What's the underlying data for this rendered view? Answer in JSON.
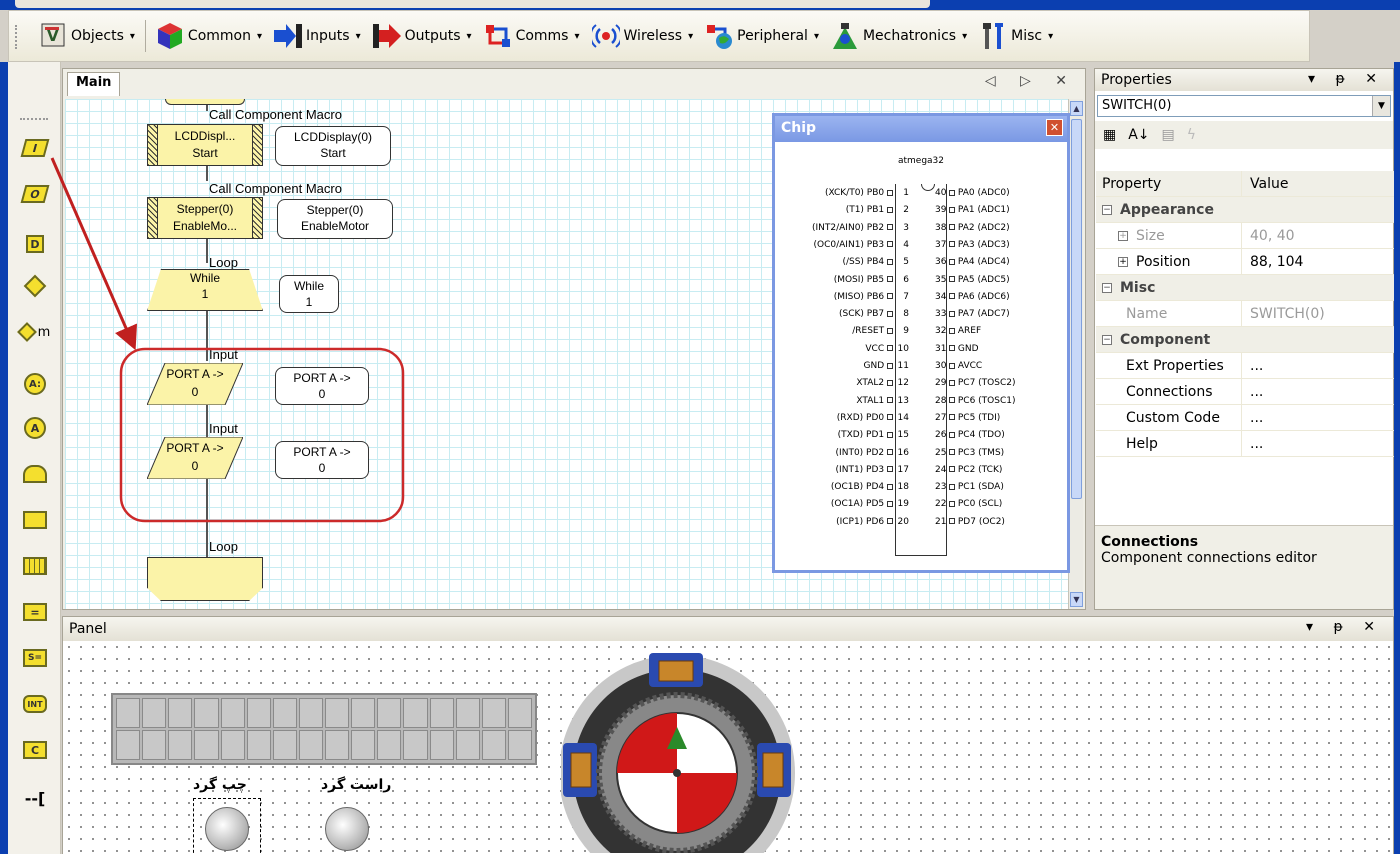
{
  "toolbar": {
    "items": [
      {
        "label": "Objects",
        "icon": "objects-icon"
      },
      {
        "label": "Common",
        "icon": "cube-icon"
      },
      {
        "label": "Inputs",
        "icon": "inputs-icon"
      },
      {
        "label": "Outputs",
        "icon": "outputs-icon"
      },
      {
        "label": "Comms",
        "icon": "comms-icon"
      },
      {
        "label": "Wireless",
        "icon": "wireless-icon"
      },
      {
        "label": "Peripheral",
        "icon": "peripheral-icon"
      },
      {
        "label": "Mechatronics",
        "icon": "mechatronics-icon"
      },
      {
        "label": "Misc",
        "icon": "tools-icon"
      }
    ],
    "arrow": "▾"
  },
  "palette": {
    "items": [
      "I",
      "O",
      "D",
      "",
      "",
      "A:",
      "A",
      "",
      "",
      "",
      "=",
      "S=",
      "INT",
      "C",
      "--["
    ]
  },
  "main": {
    "tab": "Main",
    "controls": "◁ ▷ ✕",
    "flow": {
      "call1_label": "Call Component Macro",
      "macro1_line1": "LCDDispl...",
      "macro1_line2": "Start",
      "callout1_line1": "LCDDisplay(0)",
      "callout1_line2": "Start",
      "call2_label": "Call Component Macro",
      "macro2_line1": "Stepper(0)",
      "macro2_line2": "EnableMo...",
      "callout2_line1": "Stepper(0)",
      "callout2_line2": "EnableMotor",
      "loop_label": "Loop",
      "while_line1": "While",
      "while_line2": "1",
      "while_callout1": "While",
      "while_callout2": "1",
      "input1_label": "Input",
      "input1_line1": "PORT A ->",
      "input1_line2": "0",
      "input1_callout1": "PORT A ->",
      "input1_callout2": "0",
      "input2_label": "Input",
      "input2_line1": "PORT A ->",
      "input2_line2": "0",
      "input2_callout1": "PORT A ->",
      "input2_callout2": "0",
      "loop_end_label": "Loop"
    }
  },
  "chip": {
    "title": "Chip",
    "close": "✕",
    "name": "atmega32",
    "left_pins": [
      "(XCK/T0) PB0",
      "(T1) PB1",
      "(INT2/AIN0) PB2",
      "(OC0/AIN1) PB3",
      "(/SS) PB4",
      "(MOSI) PB5",
      "(MISO) PB6",
      "(SCK) PB7",
      "/RESET",
      "VCC",
      "GND",
      "XTAL2",
      "XTAL1",
      "(RXD) PD0",
      "(TXD) PD1",
      "(INT0) PD2",
      "(INT1) PD3",
      "(OC1B) PD4",
      "(OC1A) PD5",
      "(ICP1) PD6"
    ],
    "right_pins": [
      "PA0 (ADC0)",
      "PA1 (ADC1)",
      "PA2 (ADC2)",
      "PA3 (ADC3)",
      "PA4 (ADC4)",
      "PA5 (ADC5)",
      "PA6 (ADC6)",
      "PA7 (ADC7)",
      "AREF",
      "GND",
      "AVCC",
      "PC7 (TOSC2)",
      "PC6 (TOSC1)",
      "PC5 (TDI)",
      "PC4 (TDO)",
      "PC3 (TMS)",
      "PC2 (TCK)",
      "PC1 (SDA)",
      "PC0 (SCL)",
      "PD7 (OC2)"
    ]
  },
  "properties": {
    "title": "Properties",
    "controls": "▾ ⁠ᵽ ✕",
    "selected": "SWITCH(0)",
    "col_property": "Property",
    "col_value": "Value",
    "cat_appearance": "Appearance",
    "size_label": "Size",
    "size_value": "40, 40",
    "position_label": "Position",
    "position_value": "88, 104",
    "cat_misc": "Misc",
    "name_label": "Name",
    "name_value": "SWITCH(0)",
    "cat_component": "Component",
    "ext_label": "Ext Properties",
    "ext_value": "...",
    "conn_label": "Connections",
    "conn_value": "...",
    "code_label": "Custom Code",
    "code_value": "...",
    "help_label": "Help",
    "help_value": "...",
    "desc_title": "Connections",
    "desc_text": "Component connections editor"
  },
  "panel": {
    "title": "Panel",
    "controls": "▾ ᵽ ✕",
    "left_button_label": "چپ گرد",
    "right_button_label": "راست گرد"
  },
  "colors": {
    "accent": "#0b3fb0",
    "flow_fill": "#fbf3a8",
    "highlight": "#cc2a2a"
  }
}
